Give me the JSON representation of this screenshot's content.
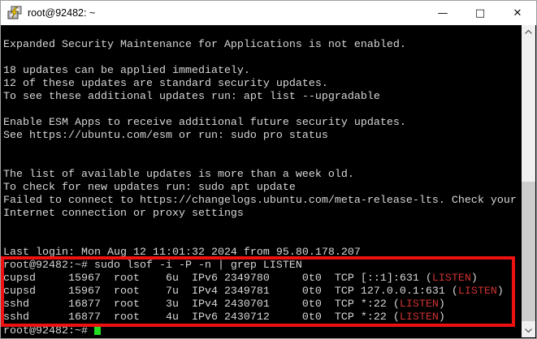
{
  "window": {
    "title": "root@92482: ~",
    "app_icon": "putty-icon",
    "controls": {
      "minimize_glyph": "—",
      "maximize_glyph": "□",
      "close_glyph": "✕"
    }
  },
  "colors": {
    "term-bg": "#000000",
    "term-fg": "#d7d7d7",
    "match-red": "#cd3131",
    "cursor-green": "#22dd22",
    "box-red": "#ee1111",
    "titlebar-bg": "#ffffff",
    "title-fg": "#000000",
    "scroll-track": "#f0f0f0",
    "scroll-thumb": "#cdcdcd",
    "scroll-arrow": "#505050"
  },
  "terminal": {
    "lines": [
      {
        "parts": [
          {
            "t": ""
          }
        ]
      },
      {
        "parts": [
          {
            "t": "Expanded Security Maintenance for Applications is not enabled."
          }
        ]
      },
      {
        "parts": [
          {
            "t": ""
          }
        ]
      },
      {
        "parts": [
          {
            "t": "18 updates can be applied immediately."
          }
        ]
      },
      {
        "parts": [
          {
            "t": "12 of these updates are standard security updates."
          }
        ]
      },
      {
        "parts": [
          {
            "t": "To see these additional updates run: apt list --upgradable"
          }
        ]
      },
      {
        "parts": [
          {
            "t": ""
          }
        ]
      },
      {
        "parts": [
          {
            "t": "Enable ESM Apps to receive additional future security updates."
          }
        ]
      },
      {
        "parts": [
          {
            "t": "See https://ubuntu.com/esm or run: sudo pro status"
          }
        ]
      },
      {
        "parts": [
          {
            "t": ""
          }
        ]
      },
      {
        "parts": [
          {
            "t": ""
          }
        ]
      },
      {
        "parts": [
          {
            "t": "The list of available updates is more than a week old."
          }
        ]
      },
      {
        "parts": [
          {
            "t": "To check for new updates run: sudo apt update"
          }
        ]
      },
      {
        "parts": [
          {
            "t": "Failed to connect to https://changelogs.ubuntu.com/meta-release-lts. Check your"
          }
        ]
      },
      {
        "parts": [
          {
            "t": "Internet connection or proxy settings"
          }
        ]
      },
      {
        "parts": [
          {
            "t": ""
          }
        ]
      },
      {
        "parts": [
          {
            "t": ""
          }
        ]
      },
      {
        "parts": [
          {
            "t": "Last login: Mon Aug 12 11:01:32 2024 from 95.80.178.207"
          }
        ]
      },
      {
        "parts": [
          {
            "t": "root@92482:~# sudo lsof -i -P -n | grep LISTEN"
          }
        ]
      },
      {
        "parts": [
          {
            "t": "cupsd     15967  root    6u  IPv6 2349780     0t0  TCP [::1]:631 ("
          },
          {
            "t": "LISTEN",
            "c": "red"
          },
          {
            "t": ")"
          }
        ]
      },
      {
        "parts": [
          {
            "t": "cupsd     15967  root    7u  IPv4 2349781     0t0  TCP 127.0.0.1:631 ("
          },
          {
            "t": "LISTEN",
            "c": "red"
          },
          {
            "t": ")"
          }
        ]
      },
      {
        "parts": [
          {
            "t": "sshd      16877  root    3u  IPv4 2430701     0t0  TCP *:22 ("
          },
          {
            "t": "LISTEN",
            "c": "red"
          },
          {
            "t": ")"
          }
        ]
      },
      {
        "parts": [
          {
            "t": "sshd      16877  root    4u  IPv6 2430712     0t0  TCP *:22 ("
          },
          {
            "t": "LISTEN",
            "c": "red"
          },
          {
            "t": ")"
          }
        ]
      },
      {
        "parts": [
          {
            "t": "root@92482:~# "
          }
        ],
        "cursor": true
      }
    ]
  },
  "annotation": {
    "type": "highlight-rectangle",
    "color": "#ee1111"
  },
  "scrollbar": {
    "up_icon": "chevron-up-icon",
    "down_icon": "chevron-down-icon"
  }
}
